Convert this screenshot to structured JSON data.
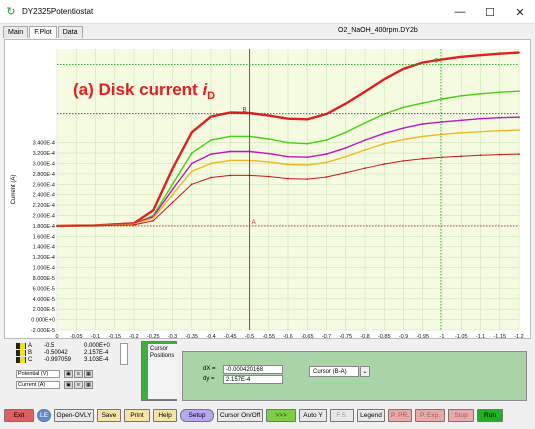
{
  "window": {
    "title": "DY2325Potentiostat",
    "minimize": "—",
    "maximize": "☐",
    "close": "✕"
  },
  "tabs": [
    "Main",
    "F.Plot",
    "Data"
  ],
  "filename": "O2_NaOH_400rpm.DY2b",
  "plot": {
    "annotation": "(a) Disk current ",
    "annotation_i": "i",
    "annotation_sub": "D",
    "cursor_labels": {
      "a": "A",
      "b": "B",
      "c": "C"
    }
  },
  "chart_data": {
    "type": "line",
    "xlabel": "Potential (V)",
    "ylabel": "Current (A)",
    "xlim": [
      0,
      -1.2
    ],
    "ylim": [
      -0.0002,
      0.00034
    ],
    "xticks": [
      "0",
      "-0.05",
      "-0.1",
      "-0.15",
      "-0.2",
      "-0.25",
      "-0.3",
      "-0.35",
      "-0.4",
      "-0.45",
      "-0.5",
      "-0.55",
      "-0.6",
      "-0.65",
      "-0.7",
      "-0.75",
      "-0.8",
      "-0.85",
      "-0.9",
      "-0.95",
      "-1",
      "-1.05",
      "-1.1",
      "-1.15",
      "-1.2"
    ],
    "yticks": [
      "-2.000E-5",
      "0.000E+0",
      "2.000E-5",
      "4.000E-5",
      "6.000E-5",
      "8.000E-5",
      "1.000E-4",
      "1.200E-4",
      "1.400E-4",
      "1.600E-4",
      "1.800E-4",
      "2.000E-4",
      "2.200E-4",
      "2.400E-4",
      "2.600E-4",
      "2.800E-4",
      "3.000E-4",
      "3.200E-4",
      "3.400E-4"
    ],
    "grid": true,
    "series": [
      {
        "color": "#e02020",
        "x": [
          0,
          -0.1,
          -0.2,
          -0.25,
          -0.3,
          -0.35,
          -0.4,
          -0.45,
          -0.5,
          -0.55,
          -0.6,
          -0.65,
          -0.7,
          -0.75,
          -0.8,
          -0.85,
          -0.9,
          -0.95,
          -1.0,
          -1.05,
          -1.1,
          -1.15,
          -1.2
        ],
        "y": [
          1e-07,
          1e-06,
          5e-06,
          3e-05,
          0.00011,
          0.00018,
          0.00021,
          0.000218,
          0.000217,
          0.000212,
          0.000206,
          0.000205,
          0.000215,
          0.000235,
          0.000258,
          0.000282,
          0.000302,
          0.000314,
          0.00032,
          0.000325,
          0.000328,
          0.000331,
          0.000333
        ]
      },
      {
        "color": "#44d011",
        "x": [
          0,
          -0.1,
          -0.2,
          -0.25,
          -0.3,
          -0.35,
          -0.4,
          -0.45,
          -0.5,
          -0.55,
          -0.6,
          -0.65,
          -0.7,
          -0.75,
          -0.8,
          -0.85,
          -0.9,
          -0.95,
          -1.0,
          -1.05,
          -1.1,
          -1.15,
          -1.2
        ],
        "y": [
          1e-07,
          1e-06,
          4e-06,
          2e-05,
          8e-05,
          0.00014,
          0.000165,
          0.000172,
          0.000172,
          0.000167,
          0.00016,
          0.000158,
          0.000165,
          0.00018,
          0.000198,
          0.000215,
          0.000228,
          0.000236,
          0.000244,
          0.00025,
          0.000254,
          0.000257,
          0.000259
        ]
      },
      {
        "color": "#c014c0",
        "x": [
          0,
          -0.1,
          -0.2,
          -0.25,
          -0.3,
          -0.35,
          -0.4,
          -0.45,
          -0.5,
          -0.55,
          -0.6,
          -0.65,
          -0.7,
          -0.75,
          -0.8,
          -0.85,
          -0.9,
          -0.95,
          -1.0,
          -1.05,
          -1.1,
          -1.15,
          -1.2
        ],
        "y": [
          1e-07,
          1e-06,
          4e-06,
          1.8e-05,
          7e-05,
          0.00012,
          0.000138,
          0.000143,
          0.000143,
          0.000139,
          0.000133,
          0.000132,
          0.000138,
          0.00015,
          0.000165,
          0.000178,
          0.000188,
          0.000196,
          0.0002,
          0.000203,
          0.000206,
          0.000208,
          0.000209
        ]
      },
      {
        "color": "#f0b820",
        "x": [
          0,
          -0.1,
          -0.2,
          -0.25,
          -0.3,
          -0.35,
          -0.4,
          -0.45,
          -0.5,
          -0.55,
          -0.6,
          -0.65,
          -0.7,
          -0.75,
          -0.8,
          -0.85,
          -0.9,
          -0.95,
          -1.0,
          -1.05,
          -1.1,
          -1.15,
          -1.2
        ],
        "y": [
          1e-07,
          1e-06,
          3e-06,
          1.5e-05,
          6e-05,
          0.000105,
          0.00012,
          0.000126,
          0.000126,
          0.000123,
          0.000118,
          0.000117,
          0.000122,
          0.000133,
          0.000146,
          0.000158,
          0.000166,
          0.000172,
          0.000176,
          0.000179,
          0.000181,
          0.000183,
          0.000184
        ]
      },
      {
        "color": "#c81818",
        "x": [
          0,
          -0.1,
          -0.2,
          -0.25,
          -0.3,
          -0.35,
          -0.4,
          -0.45,
          -0.5,
          -0.55,
          -0.6,
          -0.65,
          -0.7,
          -0.75,
          -0.8,
          -0.85,
          -0.9,
          -0.95,
          -1.0,
          -1.05,
          -1.1,
          -1.15,
          -1.2
        ],
        "y": [
          1e-07,
          1e-06,
          2e-06,
          1e-05,
          4.5e-05,
          8e-05,
          9.3e-05,
          9.7e-05,
          9.7e-05,
          9.5e-05,
          9.1e-05,
          9e-05,
          9.4e-05,
          0.000102,
          0.000111,
          0.000119,
          0.000125,
          0.000129,
          0.000132,
          0.000134,
          0.000136,
          0.000137,
          0.000138
        ]
      }
    ],
    "cursor_a": [
      -0.50042,
      0.0
    ],
    "cursor_b": [
      -0.50042,
      0.0002157
    ],
    "cursor_c": [
      -0.997059,
      0.0003103
    ]
  },
  "cursor_table": [
    {
      "label": "A",
      "x": "-0.5",
      "y": "0.000E+0"
    },
    {
      "label": "B",
      "x": "-0.50042",
      "y": "2.157E-4"
    },
    {
      "label": "C",
      "x": "-0.997059",
      "y": "3.103E-4"
    }
  ],
  "selects": {
    "xaxis": "Potential (V)",
    "yaxis": "Current (A)"
  },
  "cursor_positions_label": "Cursor Positions",
  "delta": {
    "dx_label": "dX =",
    "dx": "-0.000420168",
    "dy_label": "dy =",
    "dy": "2.157E-4",
    "mode": "Cursor (B-A)"
  },
  "toolbar": {
    "exit": "Exit",
    "le": "LE",
    "open_ovly": "Open-OVLY",
    "save": "Save",
    "print": "Print",
    "help": "Help",
    "setup": "Setup",
    "cursor": "Cursor On/Off",
    "autoy": "Auto Y",
    "fs": "F.S.",
    "legend": "Legend",
    "ppr": "P. PR.",
    "pexp": "P. Exp.",
    "stop": "Stop",
    "run": "Run"
  },
  "colors": {
    "exit_btn": "#e06060",
    "setup_btn": "#b9a6f0",
    "run_btn": "#22b022",
    "cursorpanel": "#a8d4a8"
  }
}
